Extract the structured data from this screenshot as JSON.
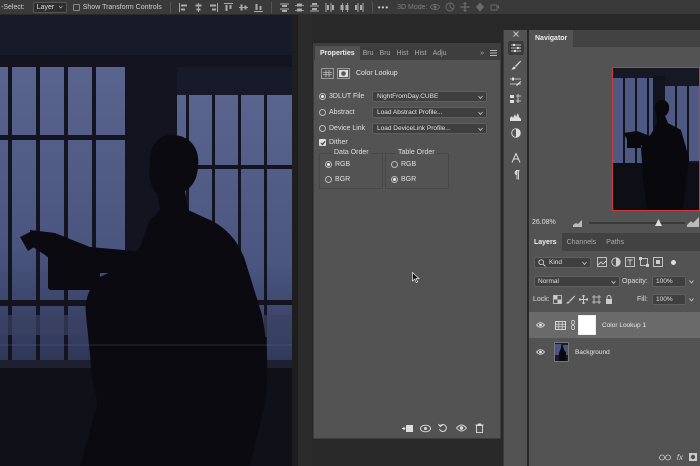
{
  "option_bar": {
    "select_label": "-Select:",
    "layer_select": "Layer",
    "show_transform_label": "Show Transform Controls",
    "mode_3d_label": "3D Mode:",
    "more_label": "•••"
  },
  "properties": {
    "tabs": [
      "Properties",
      "Bru",
      "Bru",
      "Hist",
      "Hist",
      "Adju"
    ],
    "more_tabs": "»",
    "adjustment_title": "Color Lookup",
    "rows": [
      {
        "label": "3DLUT File",
        "value": "NightFromDay.CUBE",
        "selected": true
      },
      {
        "label": "Abstract",
        "value": "Load Abstract Profile...",
        "selected": false
      },
      {
        "label": "Device Link",
        "value": "Load DeviceLink Profile...",
        "selected": false
      }
    ],
    "dither_label": "Dither",
    "dither_checked": true,
    "data_order": {
      "title": "Data Order",
      "options": [
        "RGB",
        "BGR"
      ],
      "selected": "RGB"
    },
    "table_order": {
      "title": "Table Order",
      "options": [
        "RGB",
        "BGR"
      ],
      "selected": "BGR"
    }
  },
  "navigator": {
    "tab": "Navigator",
    "zoom": "26.08%"
  },
  "layers": {
    "tabs": [
      "Layers",
      "Channels",
      "Paths"
    ],
    "kind_filter": "Kind",
    "blend_mode": "Normal",
    "opacity_label": "Opacity:",
    "opacity_value": "100%",
    "lock_label": "Lock:",
    "fill_label": "Fill:",
    "fill_value": "100%",
    "items": [
      {
        "name": "Color Lookup 1",
        "selected": true
      },
      {
        "name": "Background",
        "selected": false
      }
    ],
    "fx_label": "fx"
  },
  "colors": {
    "panel": "#535353",
    "panel_dark": "#3e3e3e",
    "app_bg": "#282828",
    "selected_row": "#6a6a6a",
    "accent_red": "#d04040"
  }
}
